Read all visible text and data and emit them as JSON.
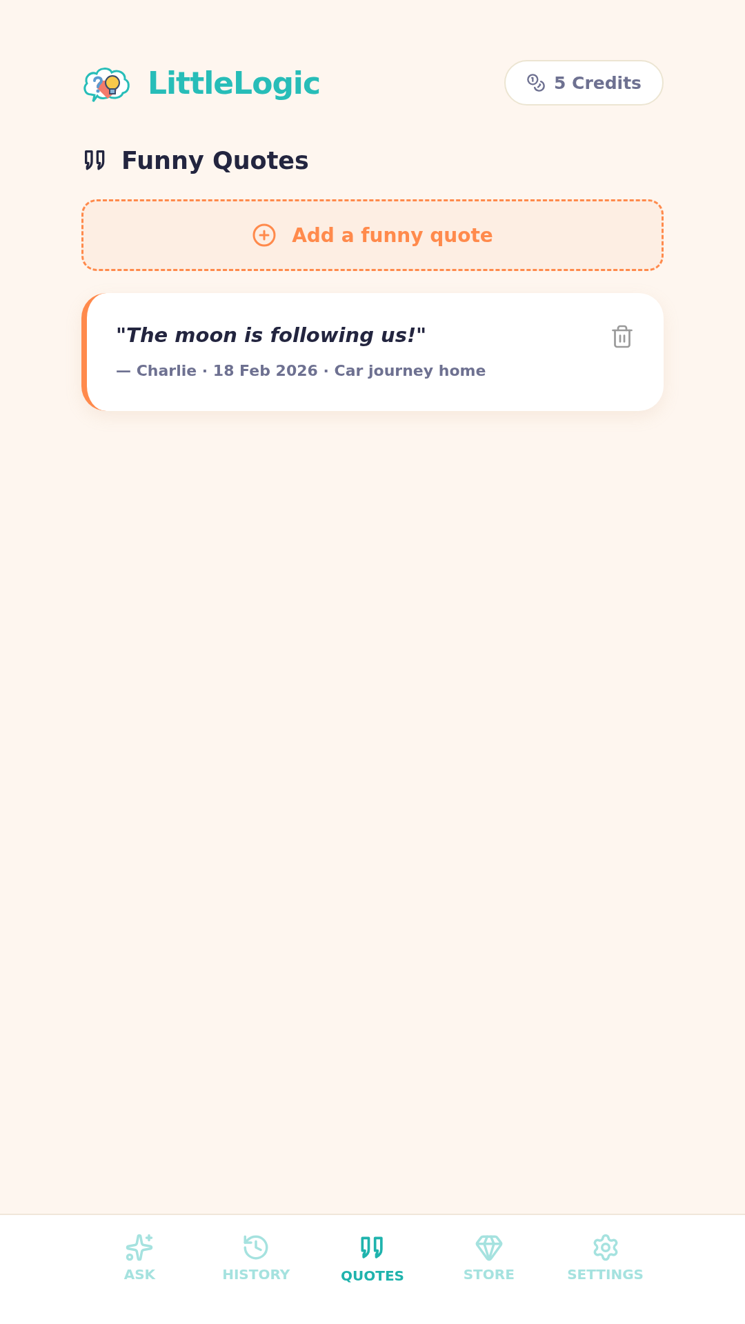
{
  "header": {
    "brand": "LittleLogic",
    "credits": "5 Credits"
  },
  "page": {
    "title": "Funny Quotes",
    "add_button": "Add a funny quote"
  },
  "quotes": [
    {
      "text": "\"The moon is following us!\"",
      "meta": "— Charlie · 18 Feb 2026 · Car journey home"
    }
  ],
  "nav": [
    {
      "kind": "ask",
      "label": "ASK",
      "selected": false
    },
    {
      "kind": "history",
      "label": "HISTORY",
      "selected": false
    },
    {
      "kind": "quotes",
      "label": "QUOTES",
      "selected": true
    },
    {
      "kind": "store",
      "label": "STORE",
      "selected": false
    },
    {
      "kind": "settings",
      "label": "SETTINGS",
      "selected": false
    }
  ]
}
